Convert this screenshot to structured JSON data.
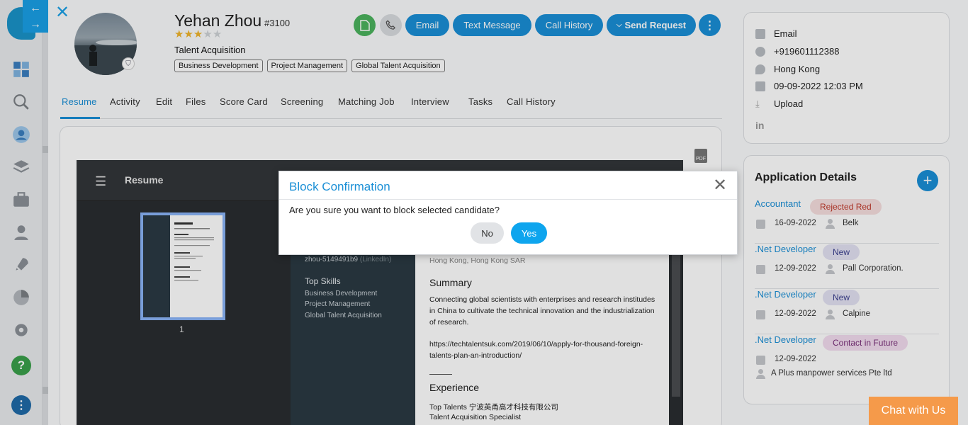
{
  "nav": {
    "back_icon": "arrow-left-icon",
    "forward_icon": "arrow-right-icon",
    "close_icon": "close-icon"
  },
  "candidate": {
    "name": "Yehan Zhou",
    "id": "#3100",
    "rating": 3,
    "rating_max": 5,
    "role": "Talent Acquisition",
    "tags": [
      "Business Development",
      "Project Management",
      "Global Talent Acquisition"
    ]
  },
  "actions": {
    "email": "Email",
    "text": "Text Message",
    "call_history": "Call History",
    "send_request": "Send Request"
  },
  "tabs": [
    "Resume",
    "Activity",
    "Edit",
    "Files",
    "Score Card",
    "Screening",
    "Matching Job",
    "Interview",
    "Tasks",
    "Call History"
  ],
  "viewer": {
    "title": "Resume",
    "page_number": "1",
    "pdf_label": "PDF",
    "left": {
      "linkedin": "zhou-5149491b9",
      "linkedin_suffix": "(LinkedIn)",
      "skills_title": "Top Skills",
      "skills": [
        "Business Development",
        "Project Management",
        "Global Talent Acquisition"
      ]
    },
    "right": {
      "location": "Hong Kong, Hong Kong SAR",
      "summary_title": "Summary",
      "summary": [
        "Connecting global scientists with enterprises and research institudes",
        "in China to cultivate the technical innovation and the industrialization",
        "of research."
      ],
      "link": [
        "https://techtalentsuk.com/2019/06/10/apply-for-thousand-foreign-",
        "talents-plan-an-introduction/"
      ],
      "experience_title": "Experience",
      "company": "Top Talents 宁波英甬高才科技有限公司",
      "position": "Talent Acquisition Specialist"
    }
  },
  "contact": {
    "email": "Email",
    "phone": "+919601112388",
    "location": "Hong Kong",
    "date": "09-09-2022 12:03 PM",
    "upload": "Upload"
  },
  "applications": {
    "title": "Application Details",
    "items": [
      {
        "job": "Accountant",
        "status": "Rejected Red",
        "status_color": "#c0392b",
        "status_bg": "#f6dede",
        "date": "16-09-2022",
        "company": "Belk"
      },
      {
        "job": ".Net Developer",
        "status": "New",
        "status_color": "#3b3f8f",
        "status_bg": "#e3e2f3",
        "date": "12-09-2022",
        "company": "Pall Corporation."
      },
      {
        "job": ".Net Developer",
        "status": "New",
        "status_color": "#3b3f8f",
        "status_bg": "#e3e2f3",
        "date": "12-09-2022",
        "company": "Calpine"
      },
      {
        "job": ".Net Developer",
        "status": "Contact in Future",
        "status_color": "#7a2f7a",
        "status_bg": "#f3dcef",
        "date": "12-09-2022",
        "company": "A Plus manpower services Pte ltd"
      }
    ]
  },
  "modal": {
    "title": "Block Confirmation",
    "message": "Are you sure you want to block selected candidate?",
    "no": "No",
    "yes": "Yes"
  },
  "chat": {
    "label": "Chat with Us"
  },
  "colors": {
    "accent": "#1a8fd6",
    "green": "#4cb35e",
    "chat": "#f59a4a"
  }
}
